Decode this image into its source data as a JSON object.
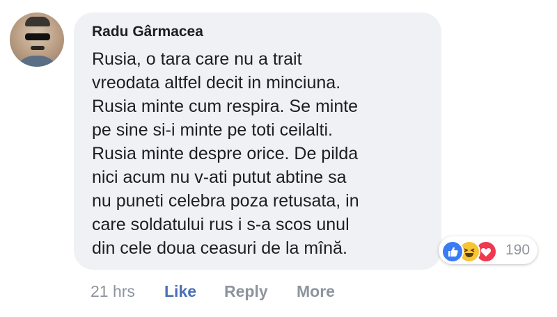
{
  "comment": {
    "author": "Radu Gârmacea",
    "text": "Rusia, o tara care nu a trait\nvreodata altfel decit in minciuna.\nRusia minte cum respira. Se minte\npe sine si-i minte pe toti ceilalti.\nRusia minte despre orice. De pilda\nnici acum nu v-ati putut abtine sa\nnu puneti celebra poza retusata, in\ncare soldatului rus i s-a scos unul\ndin cele doua ceasuri de la mînă.",
    "reaction_count": "190",
    "reaction_icons": [
      "like-icon",
      "haha-icon",
      "love-icon"
    ]
  },
  "actions": {
    "time": "21 hrs",
    "like": "Like",
    "reply": "Reply",
    "more": "More"
  },
  "colors": {
    "bubble": "#f0f1f4",
    "like_link": "#4a6fb5",
    "muted": "#8d949e",
    "like_reaction": "#3b7cf4",
    "haha_reaction": "#f7c534",
    "love_reaction": "#f0384f"
  }
}
